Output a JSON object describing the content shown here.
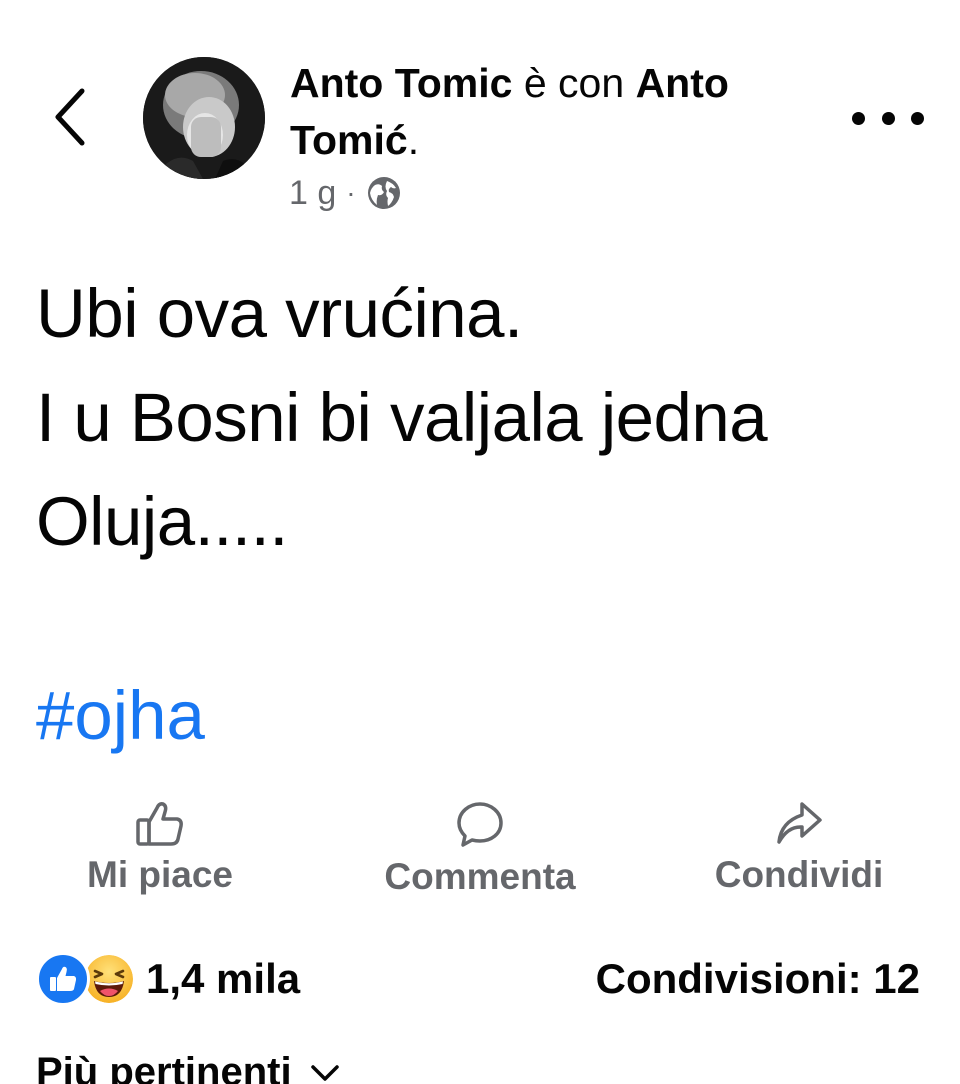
{
  "post_header": {
    "author": "Anto Tomic",
    "with_word": "è con",
    "tagged_person": "Anto Tomić",
    "tagged_suffix": ".",
    "time": "1 g",
    "separator": "·",
    "audience_icon": "globe-icon"
  },
  "post": {
    "lines": [
      "Ubi ova vrućina.",
      "I u Bosni bi valjala jedna",
      "Oluja....."
    ],
    "hashtag": "#ojha"
  },
  "actions": {
    "like_label": "Mi piace",
    "comment_label": "Commenta",
    "share_label": "Condividi"
  },
  "stats": {
    "reactions_count": "1,4 mila",
    "reaction_icons": [
      "like-reaction-icon",
      "haha-reaction-icon"
    ],
    "shares_text": "Condivisioni: 12"
  },
  "comments": {
    "sort_label": "Più pertinenti"
  },
  "colors": {
    "hashtag": "#1877f2",
    "secondary_text": "#65676b",
    "primary_text": "#050505"
  }
}
